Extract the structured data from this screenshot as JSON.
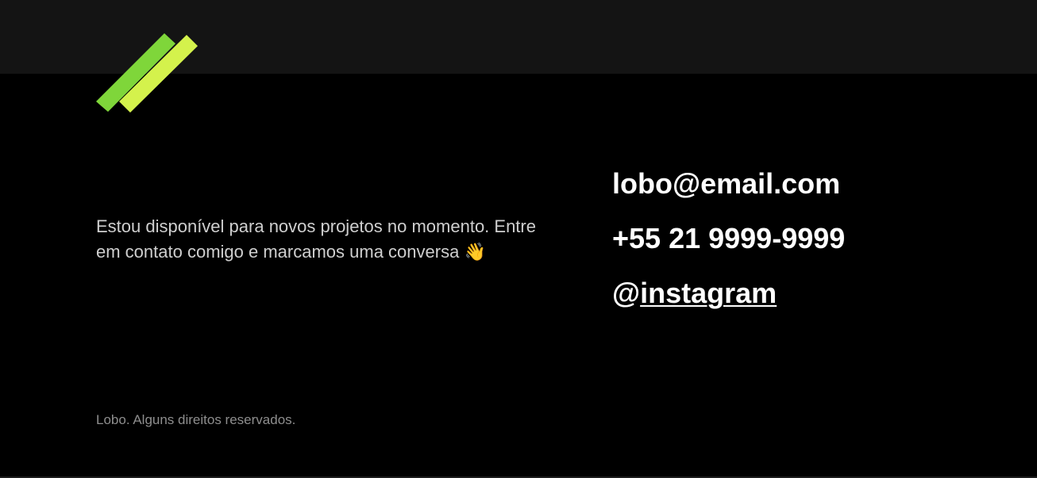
{
  "brand": {
    "logo_icon": "double-stripe-logo-icon",
    "colors": {
      "stripe_back": "#7fd63a",
      "stripe_front": "#d4f24c",
      "top_band": "#141414",
      "background": "#000000"
    }
  },
  "intro": {
    "text": "Estou disponível para novos projetos no momento. Entre em contato comigo e marcamos uma conversa",
    "emoji": "👋"
  },
  "contact": {
    "email": "lobo@email.com",
    "phone": "+55 21 9999-9999",
    "instagram_at": "@",
    "instagram_handle": "instagram"
  },
  "footer": {
    "copyright": "Lobo. Alguns direitos reservados."
  }
}
